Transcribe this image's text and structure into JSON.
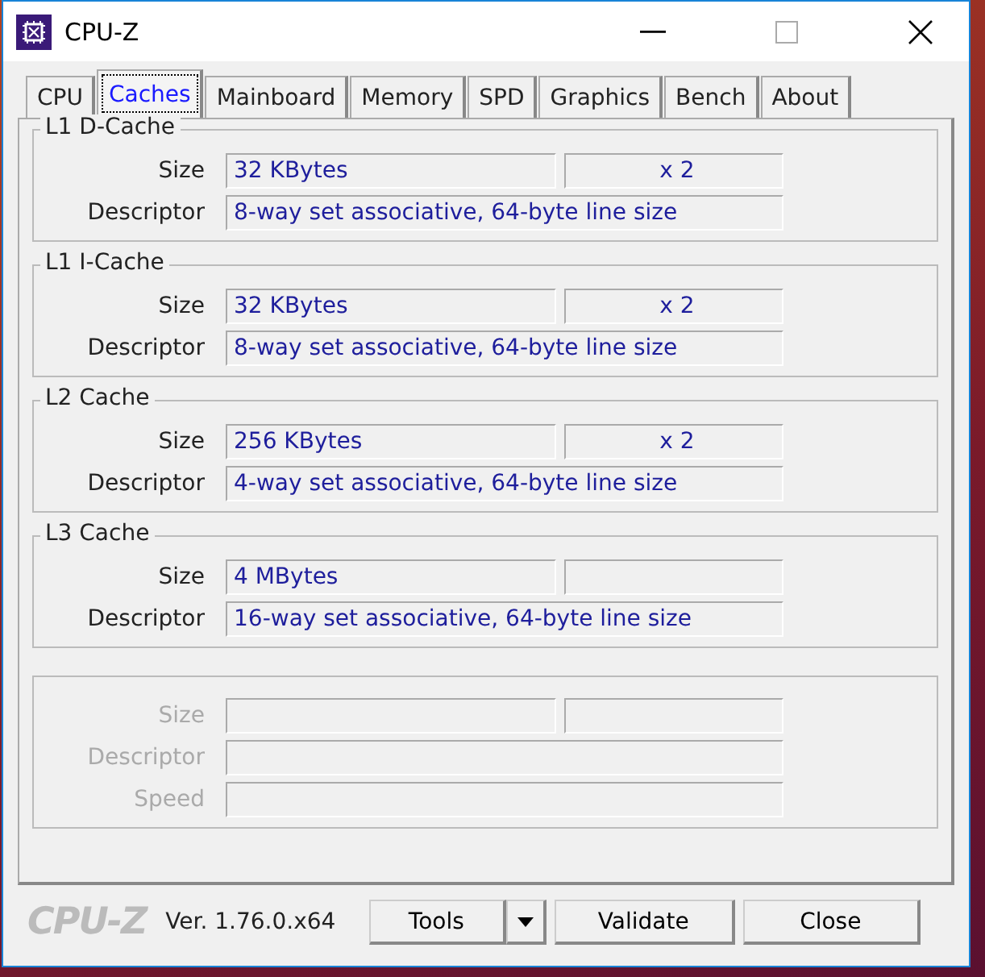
{
  "window": {
    "title": "CPU-Z"
  },
  "tabs": [
    {
      "label": "CPU",
      "selected": false
    },
    {
      "label": "Caches",
      "selected": true
    },
    {
      "label": "Mainboard",
      "selected": false
    },
    {
      "label": "Memory",
      "selected": false
    },
    {
      "label": "SPD",
      "selected": false
    },
    {
      "label": "Graphics",
      "selected": false
    },
    {
      "label": "Bench",
      "selected": false
    },
    {
      "label": "About",
      "selected": false
    }
  ],
  "groups": [
    {
      "title": "L1 D-Cache",
      "disabled": false,
      "rows": [
        {
          "kind": "split",
          "label": "Size",
          "value": "32 KBytes",
          "multiplier": "x 2"
        },
        {
          "kind": "wide",
          "label": "Descriptor",
          "value": "8-way set associative, 64-byte line size"
        }
      ]
    },
    {
      "title": "L1 I-Cache",
      "disabled": false,
      "rows": [
        {
          "kind": "split",
          "label": "Size",
          "value": "32 KBytes",
          "multiplier": "x 2"
        },
        {
          "kind": "wide",
          "label": "Descriptor",
          "value": "8-way set associative, 64-byte line size"
        }
      ]
    },
    {
      "title": "L2 Cache",
      "disabled": false,
      "rows": [
        {
          "kind": "split",
          "label": "Size",
          "value": "256 KBytes",
          "multiplier": "x 2"
        },
        {
          "kind": "wide",
          "label": "Descriptor",
          "value": "4-way set associative, 64-byte line size"
        }
      ]
    },
    {
      "title": "L3 Cache",
      "disabled": false,
      "rows": [
        {
          "kind": "split",
          "label": "Size",
          "value": "4 MBytes"
        },
        {
          "kind": "wide",
          "label": "Descriptor",
          "value": "16-way set associative, 64-byte line size"
        }
      ]
    },
    {
      "disabled": true,
      "rows": [
        {
          "kind": "split",
          "label": "Size"
        },
        {
          "kind": "wide",
          "label": "Descriptor"
        },
        {
          "kind": "wide",
          "label": "Speed"
        }
      ]
    }
  ],
  "footer": {
    "brand": "CPU-Z",
    "version": "Ver. 1.76.0.x64",
    "buttons": [
      {
        "label": "Tools",
        "kind": "split"
      },
      {
        "label": "Validate",
        "kind": "plain"
      },
      {
        "label": "Close",
        "kind": "plain"
      }
    ]
  }
}
